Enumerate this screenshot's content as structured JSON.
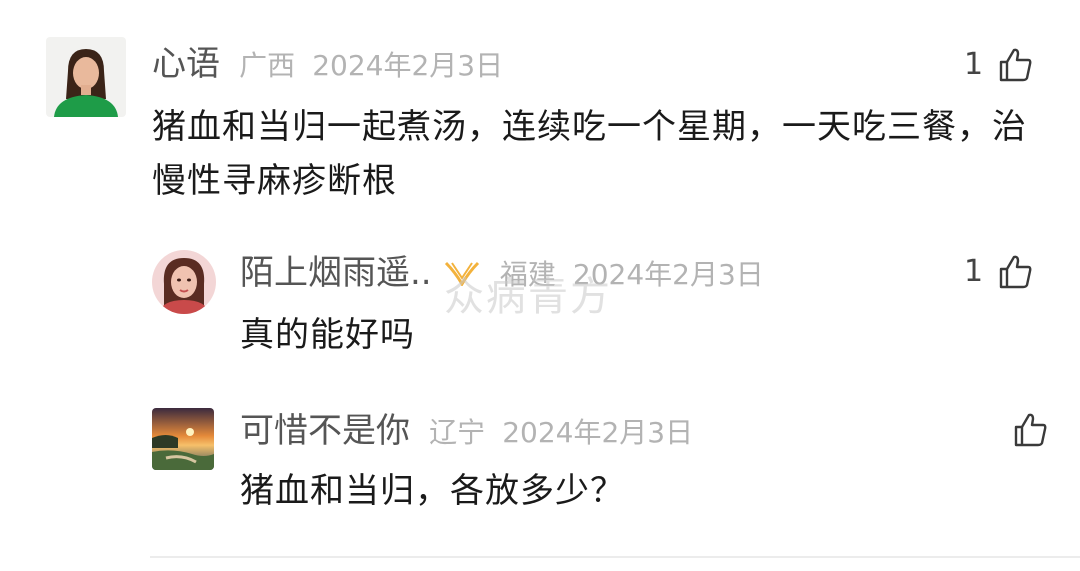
{
  "comments": [
    {
      "username": "心语",
      "location": "广西",
      "date": "2024年2月3日",
      "text": "猪血和当归一起煮汤，连续吃一个星期，一天吃三餐，治慢性寻麻疹断根",
      "like_count": "1"
    }
  ],
  "replies": [
    {
      "username": "陌上烟雨遥..",
      "location": "福建",
      "date": "2024年2月3日",
      "text": "真的能好吗",
      "like_count": "1"
    },
    {
      "username": "可惜不是你",
      "location": "辽宁",
      "date": "2024年2月3日",
      "text": "猪血和当归，各放多少？",
      "like_count": ""
    }
  ],
  "watermark": "众病青方",
  "colors": {
    "username": "#555555",
    "meta": "#b3b3b3",
    "text": "#1a1a1a",
    "badge": "#f3b23c"
  }
}
